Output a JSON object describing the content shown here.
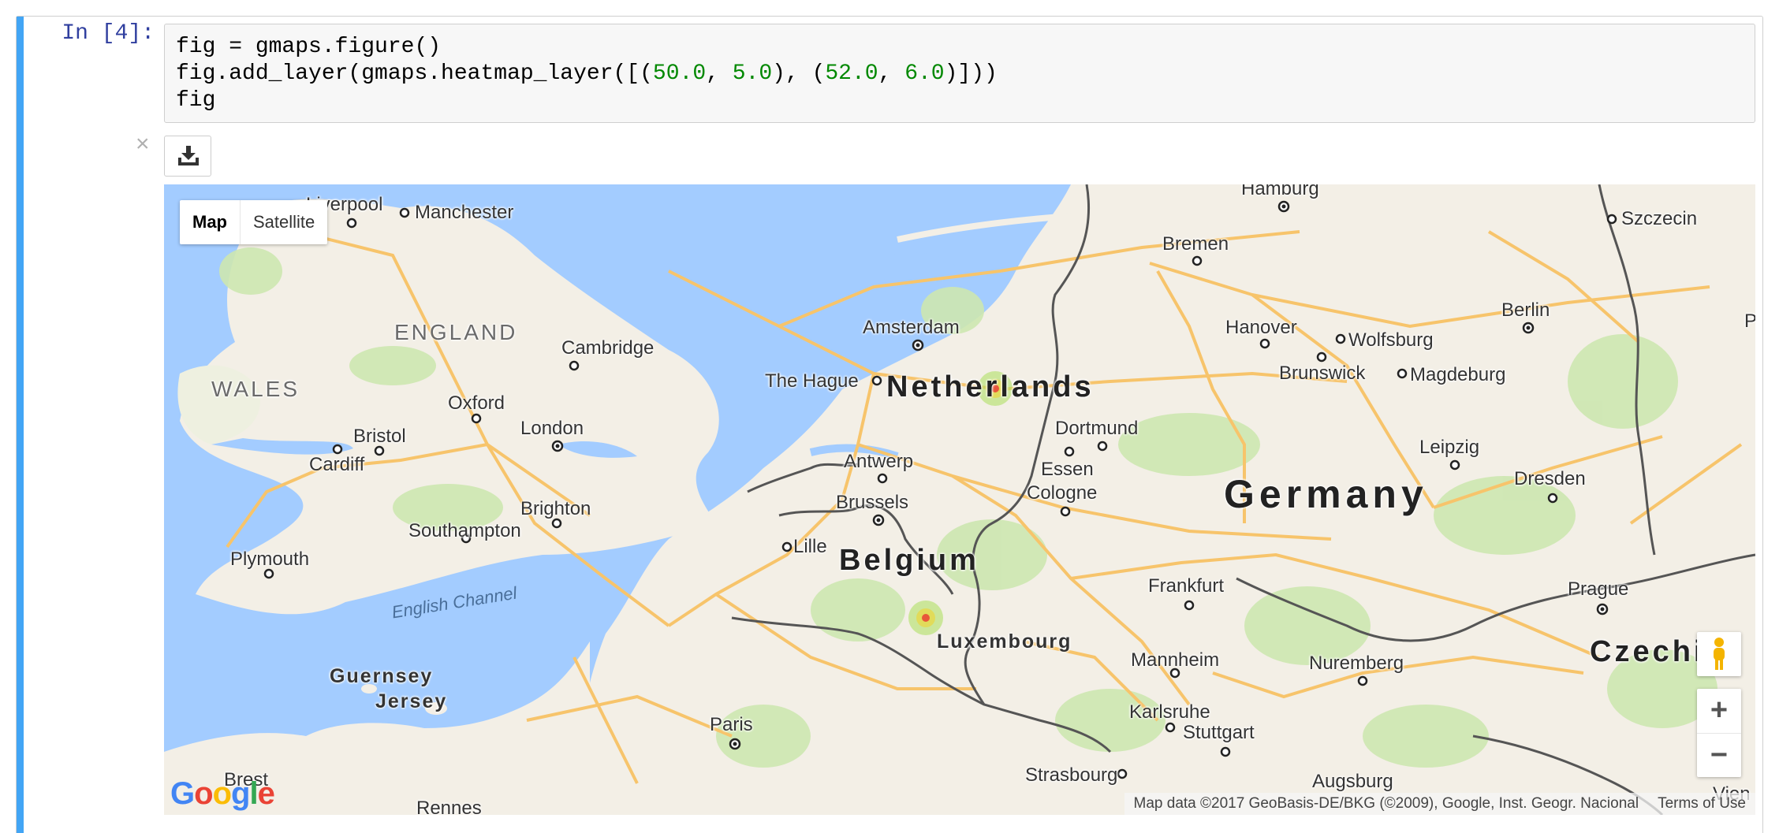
{
  "cell": {
    "prompt": "In [4]:",
    "code_lines": [
      {
        "pre": "fig = gmaps.figure()",
        "n1": "",
        "mid": "",
        "n2": "",
        "mid2": "",
        "n3": "",
        "mid3": "",
        "n4": "",
        "post": ""
      },
      {
        "pre": "fig.add_layer(gmaps.heatmap_layer([(",
        "n1": "50.0",
        "mid": ", ",
        "n2": "5.0",
        "mid2": "), (",
        "n3": "52.0",
        "mid3": ", ",
        "n4": "6.0",
        "post": ")]))"
      },
      {
        "pre": "fig",
        "n1": "",
        "mid": "",
        "n2": "",
        "mid2": "",
        "n3": "",
        "mid3": "",
        "n4": "",
        "post": ""
      }
    ]
  },
  "output": {
    "close_glyph": "×",
    "download_icon": "download-icon"
  },
  "map": {
    "map_type": {
      "map": "Map",
      "satellite": "Satellite",
      "selected": "Map"
    },
    "zoom_in": "+",
    "zoom_out": "−",
    "logo": [
      "G",
      "o",
      "o",
      "g",
      "l",
      "e"
    ],
    "logo_colors": [
      "#4285f4",
      "#ea4335",
      "#fbbc05",
      "#4285f4",
      "#34a853",
      "#ea4335"
    ],
    "attribution": "Map data ©2017 GeoBasis-DE/BKG (©2009), Google, Inst. Geogr. Nacional",
    "terms": "Terms of Use",
    "water_color": "#a3ccff",
    "land_color": "#f3efe6",
    "park_color": "#cde7b0",
    "road_color": "#f7c46b",
    "border_color": "#555555",
    "labels": {
      "liverpool": "Liverpool",
      "manchester": "Manchester",
      "hamburg": "Hamburg",
      "szczecin": "Szczecin",
      "bremen": "Bremen",
      "england": "ENGLAND",
      "cambridge": "Cambridge",
      "amsterdam": "Amsterdam",
      "berlin": "Berlin",
      "hanover": "Hanover",
      "wolfsburg": "Wolfsburg",
      "brunswick": "Brunswick",
      "magdeburg": "Magdeburg",
      "wales": "WALES",
      "the_hague": "The Hague",
      "netherlands": "Netherlands",
      "oxford": "Oxford",
      "london": "London",
      "bristol": "Bristol",
      "cardiff": "Cardiff",
      "dortmund": "Dortmund",
      "antwerp": "Antwerp",
      "essen": "Essen",
      "leipzig": "Leipzig",
      "cologne": "Cologne",
      "germany": "Germany",
      "dresden": "Dresden",
      "brussels": "Brussels",
      "brighton": "Brighton",
      "southampton": "Southampton",
      "lille": "Lille",
      "belgium": "Belgium",
      "plymouth": "Plymouth",
      "english_channel": "English Channel",
      "frankfurt": "Frankfurt",
      "prague": "Prague",
      "luxembourg": "Luxembourg",
      "czechia": "Czechia",
      "mannheim": "Mannheim",
      "nuremberg": "Nuremberg",
      "guernsey": "Guernsey",
      "jersey": "Jersey",
      "karlsruhe": "Karlsruhe",
      "paris": "Paris",
      "stuttgart": "Stuttgart",
      "strasbourg": "Strasbourg",
      "augsburg": "Augsburg",
      "brest": "Brest",
      "rennes": "Rennes",
      "vienna_partial": "Vien",
      "poland_partial": "P"
    }
  }
}
